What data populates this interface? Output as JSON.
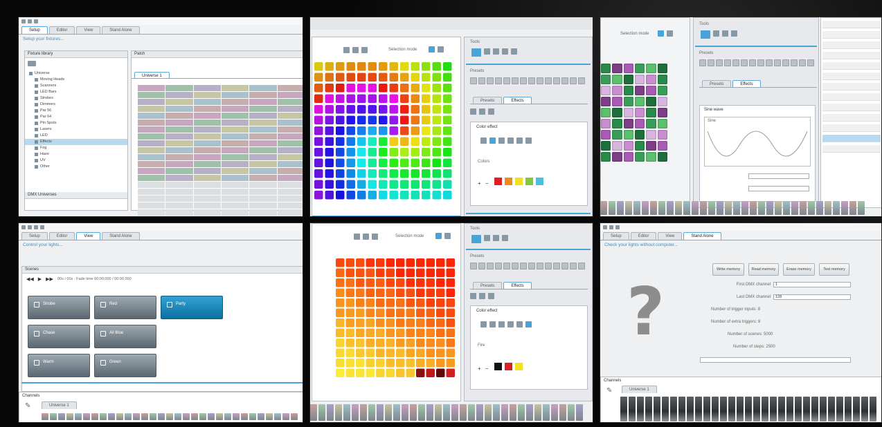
{
  "p1": {
    "tabs": [
      "Setup",
      "Editor",
      "View",
      "Stand Alone"
    ],
    "hint": "Setup your fixtures...",
    "left_title": "Fixture library",
    "right_title": "Patch",
    "tree_root": "Universe",
    "tree_items": [
      "Moving Heads",
      "Scanners",
      "LED Bars",
      "Strobes",
      "Dimmers",
      "Par 56",
      "Par 64",
      "Pin Spots",
      "Lasers",
      "LED",
      "Effects",
      "Fog",
      "Haze",
      "UV",
      "Other"
    ],
    "universe_tab": "Universe 1",
    "footer": "DMX Universes"
  },
  "p2": {
    "toolbar_label": "Selection mode",
    "side_title": "Tools",
    "side_sub": "Presets",
    "tab_a": "Presets",
    "tab_b": "Effects",
    "effect_title": "Color effect",
    "colors_label": "Colors",
    "colors": [
      "#e02020",
      "#f08a18",
      "#f4e020",
      "#80c840",
      "#4ac0e0"
    ]
  },
  "p3": {
    "toolbar_label": "Selection mode",
    "side_title": "Tools",
    "side_sub": "Presets",
    "tab_a": "Presets",
    "tab_b": "Effects",
    "wave_title": "Sine wave",
    "wave_label": "Sine"
  },
  "p4": {
    "tabs": [
      "Setup",
      "Editor",
      "View",
      "Stand Alone"
    ],
    "hint": "Control your lights...",
    "scenes_title": "Scenes",
    "transport": "00s / 00s - Fade time 00:00.000 / 00:00.000",
    "scenes": [
      "Strobe",
      "Red",
      "Party",
      "Chase",
      "All Blue",
      "Warm",
      "Green"
    ],
    "channels_title": "Channels",
    "universe_tab": "Universe 1"
  },
  "p5": {
    "toolbar_label": "Selection mode",
    "side_title": "Tools",
    "side_sub": "Presets",
    "tab_a": "Presets",
    "tab_b": "Effects",
    "effect_title": "Color effect",
    "colors_label": "Fire",
    "colors": [
      "#111111",
      "#e02020",
      "#f4e020"
    ]
  },
  "p6": {
    "tabs": [
      "Setup",
      "Editor",
      "View",
      "Stand Alone"
    ],
    "hint": "Check your lights without computer...",
    "buttons": [
      "Write memory",
      "Read memory",
      "Erase memory",
      "Test memory"
    ],
    "fields": [
      "First DMX channel",
      "Last DMX channel",
      "Number of trigger inputs",
      "Number of extra triggers",
      "Number of scenes",
      "Number of steps"
    ],
    "field_values": [
      "1",
      "128",
      "8",
      "8",
      "5000",
      "2500"
    ],
    "channels_title": "Channels",
    "universe_tab": "Universe 1"
  }
}
